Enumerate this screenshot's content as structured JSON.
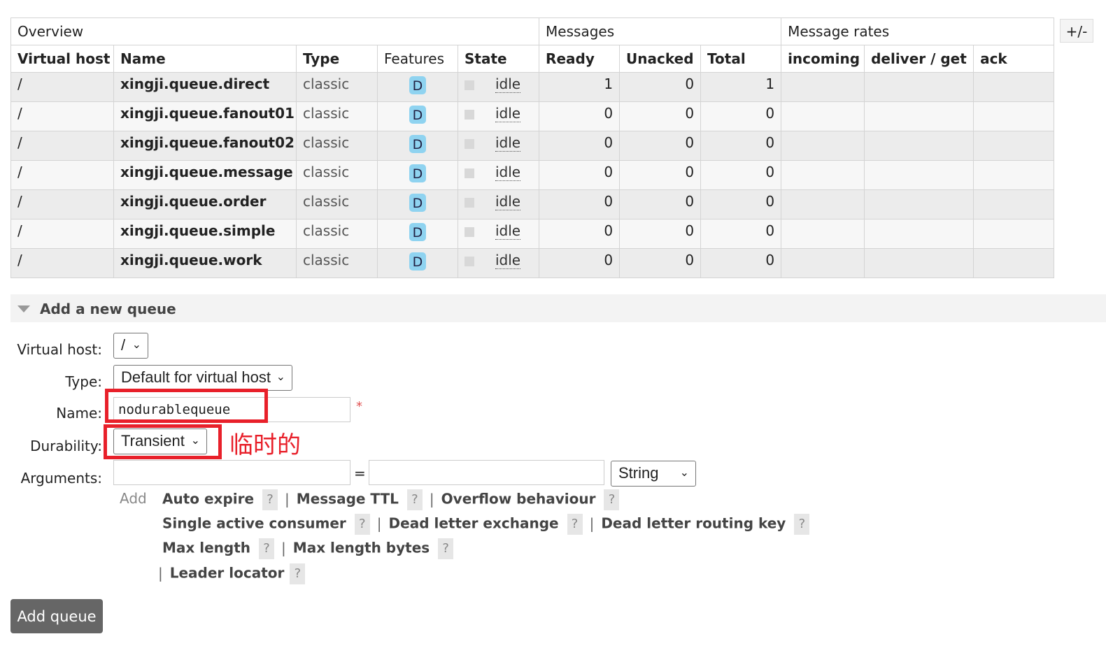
{
  "table": {
    "groups": {
      "overview": "Overview",
      "messages": "Messages",
      "rates": "Message rates"
    },
    "columns": {
      "vhost": "Virtual host",
      "name": "Name",
      "type": "Type",
      "features": "Features",
      "state": "State",
      "ready": "Ready",
      "unacked": "Unacked",
      "total": "Total",
      "incoming": "incoming",
      "deliver": "deliver / get",
      "ack": "ack"
    },
    "toggle": "+/-",
    "rows": [
      {
        "vhost": "/",
        "name": "xingji.queue.direct",
        "type": "classic",
        "feature": "D",
        "state": "idle",
        "ready": "1",
        "unacked": "0",
        "total": "1"
      },
      {
        "vhost": "/",
        "name": "xingji.queue.fanout01",
        "type": "classic",
        "feature": "D",
        "state": "idle",
        "ready": "0",
        "unacked": "0",
        "total": "0"
      },
      {
        "vhost": "/",
        "name": "xingji.queue.fanout02",
        "type": "classic",
        "feature": "D",
        "state": "idle",
        "ready": "0",
        "unacked": "0",
        "total": "0"
      },
      {
        "vhost": "/",
        "name": "xingji.queue.message",
        "type": "classic",
        "feature": "D",
        "state": "idle",
        "ready": "0",
        "unacked": "0",
        "total": "0"
      },
      {
        "vhost": "/",
        "name": "xingji.queue.order",
        "type": "classic",
        "feature": "D",
        "state": "idle",
        "ready": "0",
        "unacked": "0",
        "total": "0"
      },
      {
        "vhost": "/",
        "name": "xingji.queue.simple",
        "type": "classic",
        "feature": "D",
        "state": "idle",
        "ready": "0",
        "unacked": "0",
        "total": "0"
      },
      {
        "vhost": "/",
        "name": "xingji.queue.work",
        "type": "classic",
        "feature": "D",
        "state": "idle",
        "ready": "0",
        "unacked": "0",
        "total": "0"
      }
    ]
  },
  "add_queue": {
    "title": "Add a new queue",
    "labels": {
      "vhost": "Virtual host:",
      "type": "Type:",
      "name": "Name:",
      "durability": "Durability:",
      "arguments": "Arguments:"
    },
    "vhost_value": "/",
    "type_value": "Default for virtual host",
    "name_value": "nodurablequeue",
    "required_mark": "*",
    "durability_value": "Transient",
    "annotation": "临时的",
    "equals": "=",
    "arg_type_value": "String",
    "add_link": "Add",
    "hints": {
      "auto_expire": "Auto expire",
      "message_ttl": "Message TTL",
      "overflow": "Overflow behaviour",
      "single_active": "Single active consumer",
      "dlx": "Dead letter exchange",
      "dlrk": "Dead letter routing key",
      "max_length": "Max length",
      "max_length_bytes": "Max length bytes",
      "leader_locator": "Leader locator",
      "help": "?",
      "separator": "|"
    },
    "submit": "Add queue"
  },
  "colors": {
    "annotation_red": "#e8202a",
    "feature_badge": "#8fd3f0",
    "button_bg": "#666666"
  }
}
